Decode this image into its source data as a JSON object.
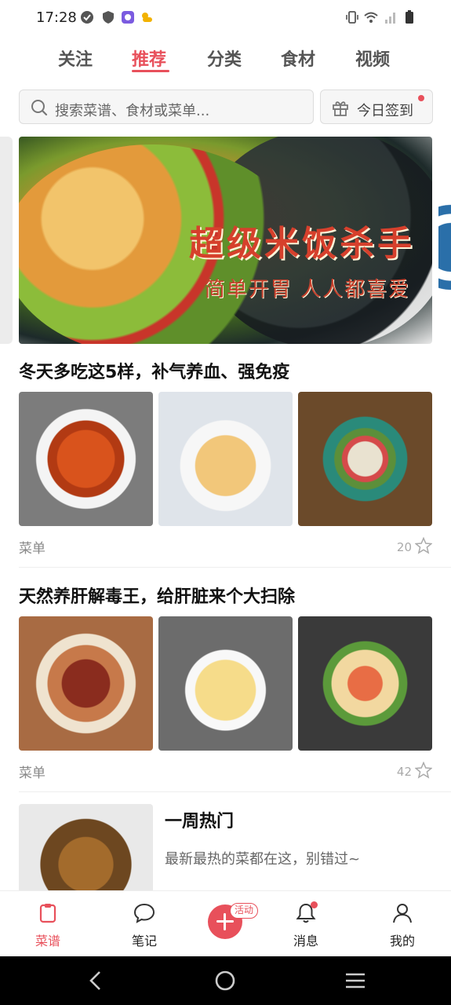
{
  "status_bar": {
    "time": "17:28"
  },
  "tabs": [
    {
      "label": "关注",
      "active": false
    },
    {
      "label": "推荐",
      "active": true
    },
    {
      "label": "分类",
      "active": false
    },
    {
      "label": "食材",
      "active": false
    },
    {
      "label": "视频",
      "active": false
    }
  ],
  "search": {
    "placeholder": "搜索菜谱、食材或菜单..."
  },
  "checkin": {
    "label": "今日签到"
  },
  "banner": {
    "slogan": "超级米饭杀手",
    "sub": "简单开胃 人人都喜爱"
  },
  "sections": [
    {
      "title": "冬天多吃这5样，补气养血、强免疫",
      "tag": "菜单",
      "count": "20"
    },
    {
      "title": "天然养肝解毒王，给肝脏来个大扫除",
      "tag": "菜单",
      "count": "42"
    }
  ],
  "weekly_hot": {
    "title": "一周热门",
    "desc": "最新最热的菜都在这，别错过~"
  },
  "bottom_nav": {
    "items": [
      {
        "label": "菜谱",
        "icon": "recipe-icon",
        "active": true
      },
      {
        "label": "笔记",
        "icon": "chat-bubble-icon",
        "active": false
      },
      {
        "label": "消息",
        "icon": "bell-icon",
        "active": false
      },
      {
        "label": "我的",
        "icon": "person-icon",
        "active": false
      }
    ],
    "add_badge": "活动"
  },
  "colors": {
    "accent": "#e8505b"
  }
}
